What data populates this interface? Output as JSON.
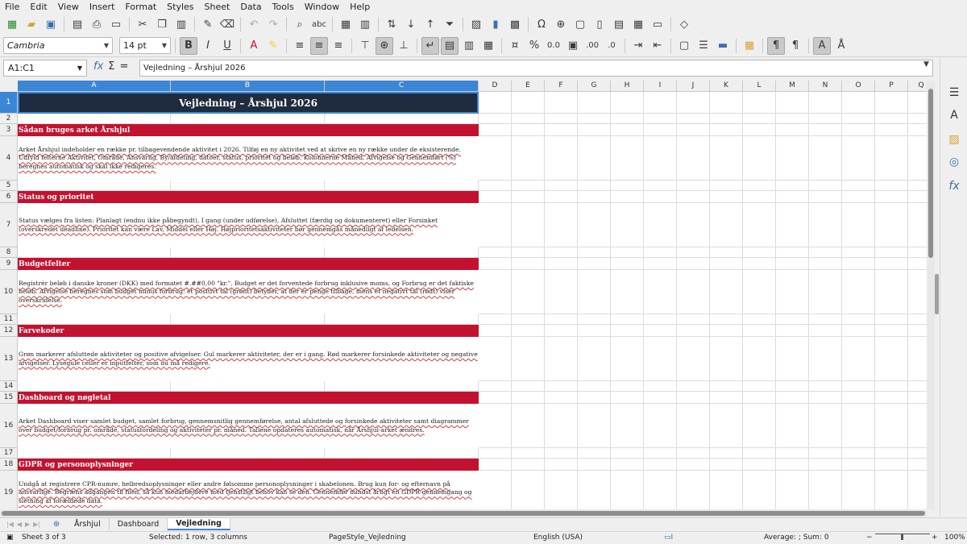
{
  "menu": [
    "File",
    "Edit",
    "View",
    "Insert",
    "Format",
    "Styles",
    "Sheet",
    "Data",
    "Tools",
    "Window",
    "Help"
  ],
  "toolbar2": {
    "font_name": "Cambria",
    "font_size": "14 pt"
  },
  "formula_bar": {
    "name_box": "A1:C1",
    "content": "Vejledning – Årshjul 2026"
  },
  "columns": [
    "A",
    "B",
    "C",
    "D",
    "E",
    "F",
    "G",
    "H",
    "I",
    "J",
    "K",
    "L",
    "M",
    "N",
    "O",
    "P",
    "Q"
  ],
  "rows": [
    {
      "num": "1",
      "type": "title",
      "text": "Vejledning – Årshjul 2026"
    },
    {
      "num": "2",
      "type": "empty",
      "text": ""
    },
    {
      "num": "3",
      "type": "head",
      "text": "Sådan bruges arket Årshjul"
    },
    {
      "num": "4",
      "type": "para",
      "text": "Arket Årshjul indeholder en række pr. tilbagevendende aktivitet i 2026. Tilføj en ny aktivitet ved at skrive en ny række under de eksisterende. Udfyld felterne Aktivitet, Område, Ansvarlig, By/afdeling, datoer, status, prioritet og beløb. Kolonnerne Måned, Afvigelse og Gennemført (%) beregnes automatisk og skal ikke redigeres."
    },
    {
      "num": "5",
      "type": "empty",
      "text": ""
    },
    {
      "num": "6",
      "type": "head",
      "text": "Status og prioritet"
    },
    {
      "num": "7",
      "type": "para",
      "text": "Status vælges fra listen: Planlagt (endnu ikke påbegyndt), I gang (under udførelse), Afsluttet (færdig og dokumenteret) eller Forsinket (overskredet deadline). Prioritet kan være Lav, Middel eller Høj. Højprioritetsaktiviteter bør gennemgås månedligt af ledelsen."
    },
    {
      "num": "8",
      "type": "empty",
      "text": ""
    },
    {
      "num": "9",
      "type": "head",
      "text": "Budgetfelter"
    },
    {
      "num": "10",
      "type": "para",
      "text": "Registrér beløb i danske kroner (DKK) med formatet #.##0,00 \"kr.\". Budget er det forventede forbrug inklusive moms, og Forbrug er det faktiske beløb. Afvigelse beregnes som budget minus forbrug: et positivt tal (grønt) betyder, at der er penge tilbage, mens et negativt tal (rødt) viser overskridelse."
    },
    {
      "num": "11",
      "type": "empty",
      "text": ""
    },
    {
      "num": "12",
      "type": "head",
      "text": "Farvekoder"
    },
    {
      "num": "13",
      "type": "para",
      "text": "Grøn markerer afsluttede aktiviteter og positive afvigelser. Gul markerer aktiviteter, der er i gang. Rød markerer forsinkede aktiviteter og negative afvigelser. Lysegule celler er inputfelter, som du må redigere."
    },
    {
      "num": "14",
      "type": "empty",
      "text": ""
    },
    {
      "num": "15",
      "type": "head",
      "text": "Dashboard og nøgletal"
    },
    {
      "num": "16",
      "type": "para",
      "text": "Arket Dashboard viser samlet budget, samlet forbrug, gennemsnitlig gennemførelse, antal afsluttede og forsinkede aktiviteter samt diagrammer over budget/forbrug pr. område, statusfordeling og aktiviteter pr. måned. Tallene opdateres automatisk, når Årshjul-arket ændres."
    },
    {
      "num": "17",
      "type": "empty",
      "text": ""
    },
    {
      "num": "18",
      "type": "head",
      "text": "GDPR og personoplysninger"
    },
    {
      "num": "19",
      "type": "para",
      "text": "Undgå at registrere CPR-numre, helbredsoplysninger eller andre følsomme personoplysninger i skabelonen. Brug kun for- og efternavn på ansvarlige. Begræns adgangen til filen, så kun medarbejdere med tjenstligt behov kan se den. Gennemfør mindst årligt en GDPR-gennemgang og sletning af forældede data."
    }
  ],
  "sheet_tabs": [
    "Årshjul",
    "Dashboard",
    "Vejledning"
  ],
  "active_tab": "Vejledning",
  "status": {
    "sheet": "Sheet 3 of 3",
    "selection": "Selected: 1 row, 3 columns",
    "page_style": "PageStyle_Vejledning",
    "language": "English (USA)",
    "sum": "Average: ; Sum: 0",
    "zoom": "100%"
  },
  "colors": {
    "accent": "#3b86d8",
    "title_bg": "#1f2b3e",
    "section_bg": "#c4112f"
  }
}
